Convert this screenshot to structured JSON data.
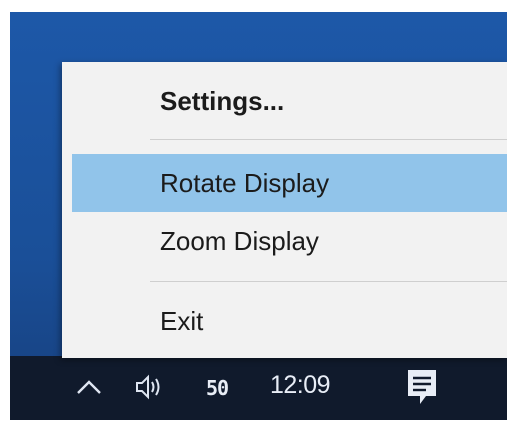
{
  "menu": {
    "items": [
      {
        "label": "Settings...",
        "bold": true
      },
      {
        "label": "Rotate Display",
        "highlighted": true
      },
      {
        "label": "Zoom Display"
      },
      {
        "label": "Exit"
      }
    ]
  },
  "taskbar": {
    "ime_label": "50",
    "clock": "12:09",
    "icons": [
      "chevron-up-icon",
      "volume-icon",
      "notification-icon"
    ]
  },
  "colors": {
    "highlight": "#91c4ea",
    "menu_bg": "#f2f2f2",
    "taskbar_bg": "#101a2c",
    "desktop": "#1d58a8"
  }
}
